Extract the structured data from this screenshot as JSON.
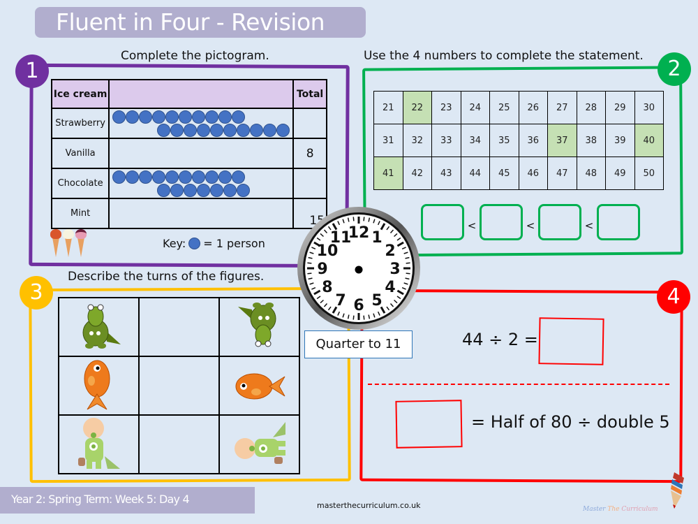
{
  "header": {
    "title": "Fluent in Four - Revision"
  },
  "colors": {
    "q1": "#7030a0",
    "q2": "#00b050",
    "q3": "#ffc000",
    "q4": "#ff0000",
    "background": "#dde8f4",
    "title_bar": "#b1aece",
    "highlight": "#c5e0b4",
    "dot": "#4472c4",
    "pictogram_header": "#dccaec"
  },
  "questions": {
    "q1": {
      "number": "1",
      "instruction": "Complete the pictogram.",
      "table": {
        "headers": [
          "Ice cream",
          "",
          "Total"
        ],
        "rows": [
          {
            "label": "Strawberry",
            "symbols": 20,
            "total": ""
          },
          {
            "label": "Vanilla",
            "symbols": 0,
            "total": "8"
          },
          {
            "label": "Chocolate",
            "symbols": 17,
            "total": ""
          },
          {
            "label": "Mint",
            "symbols": 0,
            "total": "15"
          }
        ]
      },
      "key_prefix": "Key:",
      "key_suffix": "= 1 person",
      "decoration_icons": [
        "ice-cream-strawberry-icon",
        "ice-cream-vanilla-icon",
        "ice-cream-cherry-icon"
      ]
    },
    "q2": {
      "number": "2",
      "instruction": "Use the 4 numbers to complete the statement.",
      "grid": [
        [
          21,
          22,
          23,
          24,
          25,
          26,
          27,
          28,
          29,
          30
        ],
        [
          31,
          32,
          33,
          34,
          35,
          36,
          37,
          38,
          39,
          40
        ],
        [
          41,
          42,
          43,
          44,
          45,
          46,
          47,
          48,
          49,
          50
        ]
      ],
      "highlighted": [
        22,
        37,
        40,
        41
      ],
      "comparator": "<",
      "answer_boxes": 4
    },
    "clock": {
      "numbers": [
        "12",
        "1",
        "2",
        "3",
        "4",
        "5",
        "6",
        "7",
        "8",
        "9",
        "10",
        "11"
      ],
      "label": "Quarter to 11"
    },
    "q3": {
      "number": "3",
      "instruction": "Describe the turns of the figures.",
      "rows": [
        {
          "figure": "crocodile",
          "start_icon": "crocodile-icon",
          "end_icon": "crocodile-rotated-half-turn-icon",
          "answer": ""
        },
        {
          "figure": "goldfish",
          "start_icon": "goldfish-icon",
          "end_icon": "goldfish-rotated-quarter-turn-icon",
          "answer": ""
        },
        {
          "figure": "baby",
          "start_icon": "baby-icon",
          "end_icon": "baby-rotated-quarter-turn-icon",
          "answer": ""
        }
      ]
    },
    "q4": {
      "number": "4",
      "equation1": "44 ÷ 2 =",
      "equation2": "= Half of 80 ÷ double 5"
    }
  },
  "footer": {
    "lesson": "Year 2: Spring Term: Week 5: Day 4",
    "website": "masterthecurriculum.co.uk",
    "brand_words": [
      "Master",
      "The",
      "Curriculum"
    ]
  }
}
